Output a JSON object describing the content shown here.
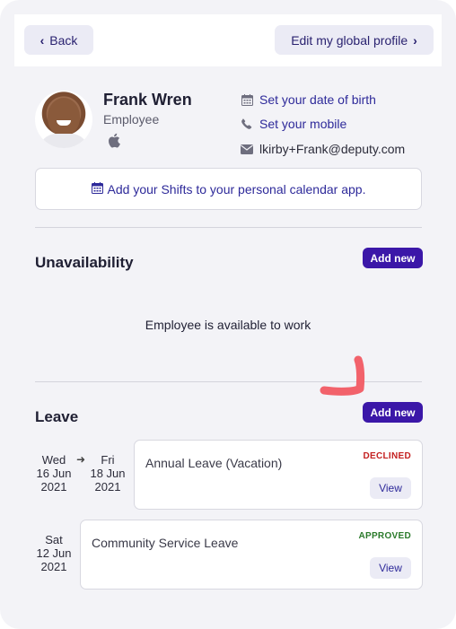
{
  "topbar": {
    "back_label": "Back",
    "profile_label": "Edit my global profile"
  },
  "profile": {
    "name": "Frank Wren",
    "role": "Employee",
    "dob_link": "Set your date of birth",
    "mobile_link": "Set your mobile",
    "email": "lkirby+Frank@deputy.com"
  },
  "calendar": {
    "label": "Add your Shifts to your personal calendar app."
  },
  "unavailability": {
    "title": "Unavailability",
    "add_label": "Add new",
    "empty_text": "Employee is available to work"
  },
  "leave": {
    "title": "Leave",
    "add_label": "Add new",
    "items": [
      {
        "start": {
          "day": "Wed",
          "date": "16 Jun",
          "year": "2021"
        },
        "end": {
          "day": "Fri",
          "date": "18 Jun",
          "year": "2021"
        },
        "type": "Annual Leave (Vacation)",
        "status": "DECLINED",
        "action": "View"
      },
      {
        "start": {
          "day": "Sat",
          "date": "12 Jun",
          "year": "2021"
        },
        "type": "Community Service Leave",
        "status": "APPROVED",
        "action": "View"
      }
    ]
  },
  "colors": {
    "accent": "#3b17a8",
    "link": "#2e2a9a",
    "declined": "#c42020",
    "approved": "#2a7a2a",
    "annotation": "#f2626b"
  },
  "icons": [
    "chevron-left-icon",
    "chevron-right-icon",
    "apple-icon",
    "calendar-icon",
    "phone-icon",
    "envelope-icon",
    "arrow-right-icon"
  ]
}
